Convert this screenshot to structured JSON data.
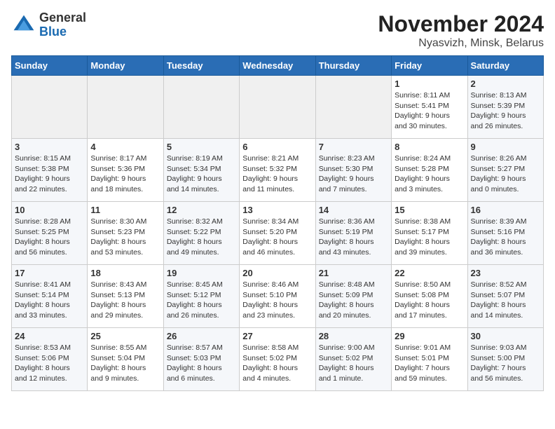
{
  "header": {
    "logo_line1": "General",
    "logo_line2": "Blue",
    "month_year": "November 2024",
    "location": "Nyasvizh, Minsk, Belarus"
  },
  "weekdays": [
    "Sunday",
    "Monday",
    "Tuesday",
    "Wednesday",
    "Thursday",
    "Friday",
    "Saturday"
  ],
  "weeks": [
    [
      {
        "day": "",
        "info": ""
      },
      {
        "day": "",
        "info": ""
      },
      {
        "day": "",
        "info": ""
      },
      {
        "day": "",
        "info": ""
      },
      {
        "day": "",
        "info": ""
      },
      {
        "day": "1",
        "info": "Sunrise: 8:11 AM\nSunset: 5:41 PM\nDaylight: 9 hours\nand 30 minutes."
      },
      {
        "day": "2",
        "info": "Sunrise: 8:13 AM\nSunset: 5:39 PM\nDaylight: 9 hours\nand 26 minutes."
      }
    ],
    [
      {
        "day": "3",
        "info": "Sunrise: 8:15 AM\nSunset: 5:38 PM\nDaylight: 9 hours\nand 22 minutes."
      },
      {
        "day": "4",
        "info": "Sunrise: 8:17 AM\nSunset: 5:36 PM\nDaylight: 9 hours\nand 18 minutes."
      },
      {
        "day": "5",
        "info": "Sunrise: 8:19 AM\nSunset: 5:34 PM\nDaylight: 9 hours\nand 14 minutes."
      },
      {
        "day": "6",
        "info": "Sunrise: 8:21 AM\nSunset: 5:32 PM\nDaylight: 9 hours\nand 11 minutes."
      },
      {
        "day": "7",
        "info": "Sunrise: 8:23 AM\nSunset: 5:30 PM\nDaylight: 9 hours\nand 7 minutes."
      },
      {
        "day": "8",
        "info": "Sunrise: 8:24 AM\nSunset: 5:28 PM\nDaylight: 9 hours\nand 3 minutes."
      },
      {
        "day": "9",
        "info": "Sunrise: 8:26 AM\nSunset: 5:27 PM\nDaylight: 9 hours\nand 0 minutes."
      }
    ],
    [
      {
        "day": "10",
        "info": "Sunrise: 8:28 AM\nSunset: 5:25 PM\nDaylight: 8 hours\nand 56 minutes."
      },
      {
        "day": "11",
        "info": "Sunrise: 8:30 AM\nSunset: 5:23 PM\nDaylight: 8 hours\nand 53 minutes."
      },
      {
        "day": "12",
        "info": "Sunrise: 8:32 AM\nSunset: 5:22 PM\nDaylight: 8 hours\nand 49 minutes."
      },
      {
        "day": "13",
        "info": "Sunrise: 8:34 AM\nSunset: 5:20 PM\nDaylight: 8 hours\nand 46 minutes."
      },
      {
        "day": "14",
        "info": "Sunrise: 8:36 AM\nSunset: 5:19 PM\nDaylight: 8 hours\nand 43 minutes."
      },
      {
        "day": "15",
        "info": "Sunrise: 8:38 AM\nSunset: 5:17 PM\nDaylight: 8 hours\nand 39 minutes."
      },
      {
        "day": "16",
        "info": "Sunrise: 8:39 AM\nSunset: 5:16 PM\nDaylight: 8 hours\nand 36 minutes."
      }
    ],
    [
      {
        "day": "17",
        "info": "Sunrise: 8:41 AM\nSunset: 5:14 PM\nDaylight: 8 hours\nand 33 minutes."
      },
      {
        "day": "18",
        "info": "Sunrise: 8:43 AM\nSunset: 5:13 PM\nDaylight: 8 hours\nand 29 minutes."
      },
      {
        "day": "19",
        "info": "Sunrise: 8:45 AM\nSunset: 5:12 PM\nDaylight: 8 hours\nand 26 minutes."
      },
      {
        "day": "20",
        "info": "Sunrise: 8:46 AM\nSunset: 5:10 PM\nDaylight: 8 hours\nand 23 minutes."
      },
      {
        "day": "21",
        "info": "Sunrise: 8:48 AM\nSunset: 5:09 PM\nDaylight: 8 hours\nand 20 minutes."
      },
      {
        "day": "22",
        "info": "Sunrise: 8:50 AM\nSunset: 5:08 PM\nDaylight: 8 hours\nand 17 minutes."
      },
      {
        "day": "23",
        "info": "Sunrise: 8:52 AM\nSunset: 5:07 PM\nDaylight: 8 hours\nand 14 minutes."
      }
    ],
    [
      {
        "day": "24",
        "info": "Sunrise: 8:53 AM\nSunset: 5:06 PM\nDaylight: 8 hours\nand 12 minutes."
      },
      {
        "day": "25",
        "info": "Sunrise: 8:55 AM\nSunset: 5:04 PM\nDaylight: 8 hours\nand 9 minutes."
      },
      {
        "day": "26",
        "info": "Sunrise: 8:57 AM\nSunset: 5:03 PM\nDaylight: 8 hours\nand 6 minutes."
      },
      {
        "day": "27",
        "info": "Sunrise: 8:58 AM\nSunset: 5:02 PM\nDaylight: 8 hours\nand 4 minutes."
      },
      {
        "day": "28",
        "info": "Sunrise: 9:00 AM\nSunset: 5:02 PM\nDaylight: 8 hours\nand 1 minute."
      },
      {
        "day": "29",
        "info": "Sunrise: 9:01 AM\nSunset: 5:01 PM\nDaylight: 7 hours\nand 59 minutes."
      },
      {
        "day": "30",
        "info": "Sunrise: 9:03 AM\nSunset: 5:00 PM\nDaylight: 7 hours\nand 56 minutes."
      }
    ]
  ]
}
